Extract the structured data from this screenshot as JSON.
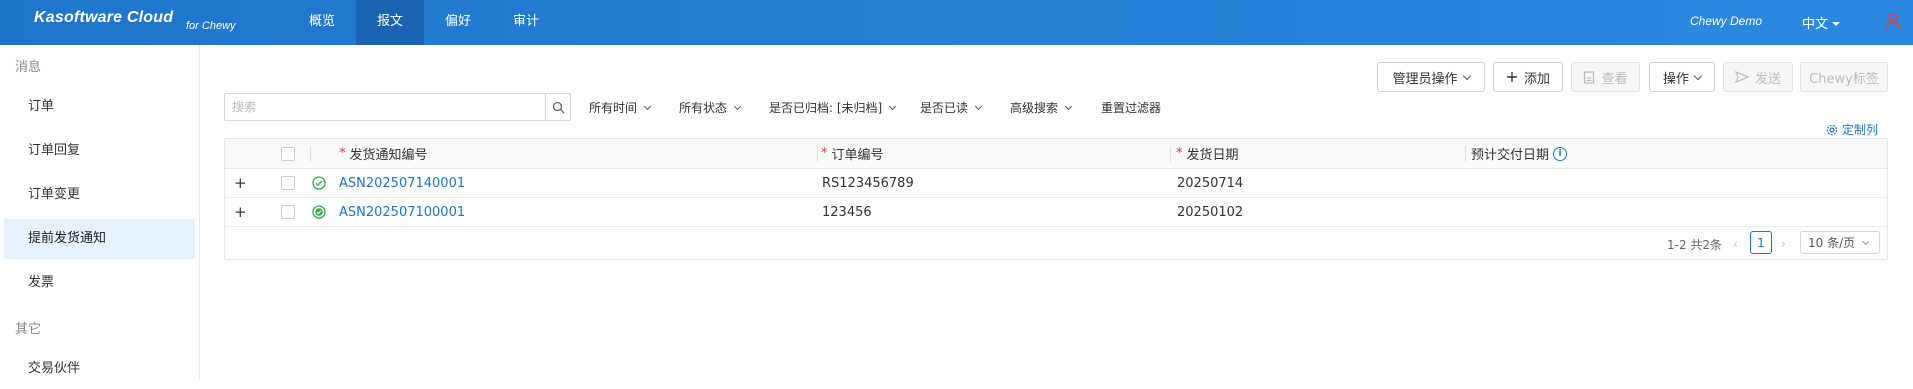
{
  "header": {
    "brand": "Kasoftware Cloud",
    "brand_sub": "for Chewy",
    "nav": [
      {
        "label": "概览"
      },
      {
        "label": "报文",
        "active": true
      },
      {
        "label": "偏好"
      },
      {
        "label": "审计"
      }
    ],
    "user_name": "Chewy Demo",
    "language": "中文",
    "colors": {
      "bar": "#1f75cb",
      "active_nav": "#1a63b0",
      "user_icon": "#e8403a"
    }
  },
  "sidebar": {
    "group1": "消息",
    "items1": [
      {
        "label": "订单"
      },
      {
        "label": "订单回复"
      },
      {
        "label": "订单变更"
      },
      {
        "label": "提前发货通知",
        "active": true
      },
      {
        "label": "发票"
      }
    ],
    "group2": "其它",
    "items2": [
      {
        "label": "交易伙伴"
      }
    ]
  },
  "toolbar": {
    "admin_ops": "管理员操作",
    "add": "添加",
    "view": "查看",
    "actions": "操作",
    "send": "发送",
    "chewy_tag": "Chewy标签"
  },
  "search": {
    "placeholder": "搜索",
    "value": ""
  },
  "filters": [
    {
      "label": "所有时间"
    },
    {
      "label": "所有状态"
    },
    {
      "label": "是否已归档: [未归档]"
    },
    {
      "label": "是否已读"
    },
    {
      "label": "高级搜索"
    },
    {
      "label": "重置过滤器",
      "no_caret": true
    }
  ],
  "customize": "定制列",
  "table": {
    "columns": [
      {
        "label": "发货通知编号",
        "required": true
      },
      {
        "label": "订单编号",
        "required": true
      },
      {
        "label": "发货日期",
        "required": true
      },
      {
        "label": "预计交付日期",
        "info": true
      }
    ],
    "rows": [
      {
        "asn": "ASN202507140001",
        "order": "RS123456789",
        "ship_date": "20250714",
        "eta": "",
        "status": "success-icon"
      },
      {
        "asn": "ASN202507100001",
        "order": "123456",
        "ship_date": "20250102",
        "eta": "",
        "status": "success-filled-icon"
      }
    ]
  },
  "pagination": {
    "summary": "1-2 共2条",
    "current": "1",
    "page_size": "10 条/页"
  }
}
